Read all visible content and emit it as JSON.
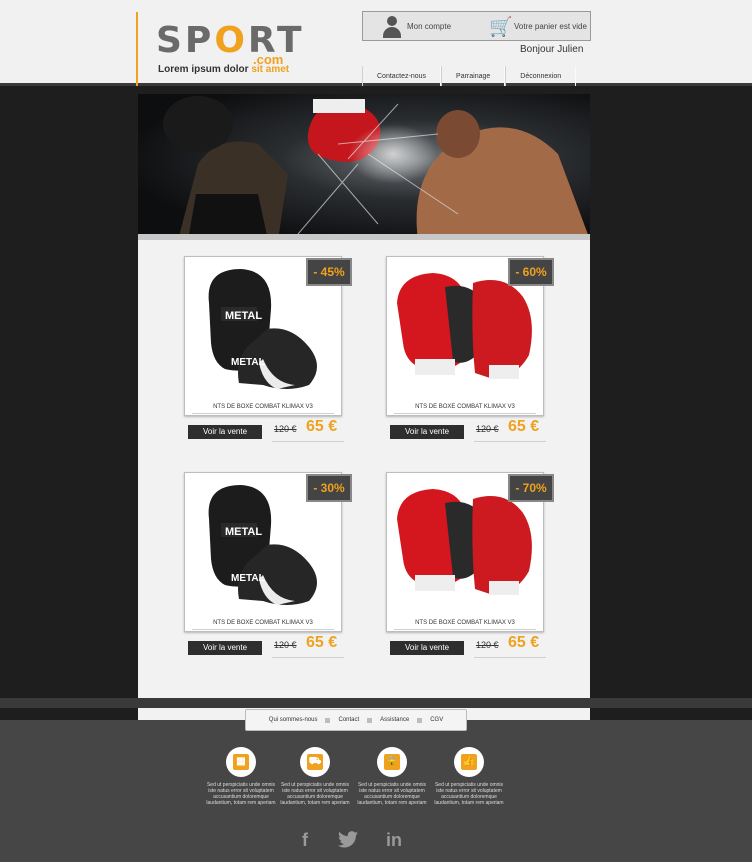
{
  "brand": {
    "logo_prefix": "SP",
    "logo_o": "O",
    "logo_suffix": "RT",
    "logo_dotcom": ".com",
    "tagline_main": "Lorem ipsum dolor ",
    "tagline_accent": "sit amet",
    "accent_color": "#f0a21f"
  },
  "account": {
    "account_label": "Mon compte",
    "cart_label": "Votre panier est vide",
    "greeting": "Bonjour Julien"
  },
  "nav": {
    "items": [
      {
        "label": "Contactez-nous"
      },
      {
        "label": "Parrainage"
      },
      {
        "label": "Déconnexion"
      }
    ]
  },
  "products": [
    {
      "name": "NTS DE BOXE COMBAT KLIMAX V3",
      "discount": "- 45%",
      "old_price": "120 €",
      "new_price": "65 €",
      "button": "Voir la vente",
      "glove": "black"
    },
    {
      "name": "NTS DE BOXE COMBAT KLIMAX V3",
      "discount": "- 60%",
      "old_price": "120 €",
      "new_price": "65 €",
      "button": "Voir la vente",
      "glove": "red"
    },
    {
      "name": "NTS DE BOXE COMBAT KLIMAX V3",
      "discount": "- 30%",
      "old_price": "120 €",
      "new_price": "65 €",
      "button": "Voir la vente",
      "glove": "black"
    },
    {
      "name": "NTS DE BOXE COMBAT KLIMAX V3",
      "discount": "- 70%",
      "old_price": "120 €",
      "new_price": "65 €",
      "button": "Voir la vente",
      "glove": "red"
    }
  ],
  "footer_nav": {
    "items": [
      {
        "label": "Qui sommes-nous"
      },
      {
        "label": "Contact"
      },
      {
        "label": "Assistance"
      },
      {
        "label": "CGV"
      }
    ]
  },
  "features": [
    {
      "icon": "package-icon",
      "text": "Sed ut perspiciatis unde omnis iste natus error sit voluptatem accusantium doloremque laudantium, totam rem aperiam"
    },
    {
      "icon": "truck-icon",
      "text": "Sed ut perspiciatis unde omnis iste natus error sit voluptatem accusantium doloremque laudantium, totam rem aperiam"
    },
    {
      "icon": "lock-icon",
      "text": "Sed ut perspiciatis unde omnis iste natus error sit voluptatem accusantium doloremque laudantium, totam rem aperiam"
    },
    {
      "icon": "thumbs-up-icon",
      "text": "Sed ut perspiciatis unde omnis iste natus error sit voluptatem accusantium doloremque laudantium, totam rem aperiam"
    }
  ],
  "social": {
    "facebook": "f",
    "linkedin": "in"
  }
}
